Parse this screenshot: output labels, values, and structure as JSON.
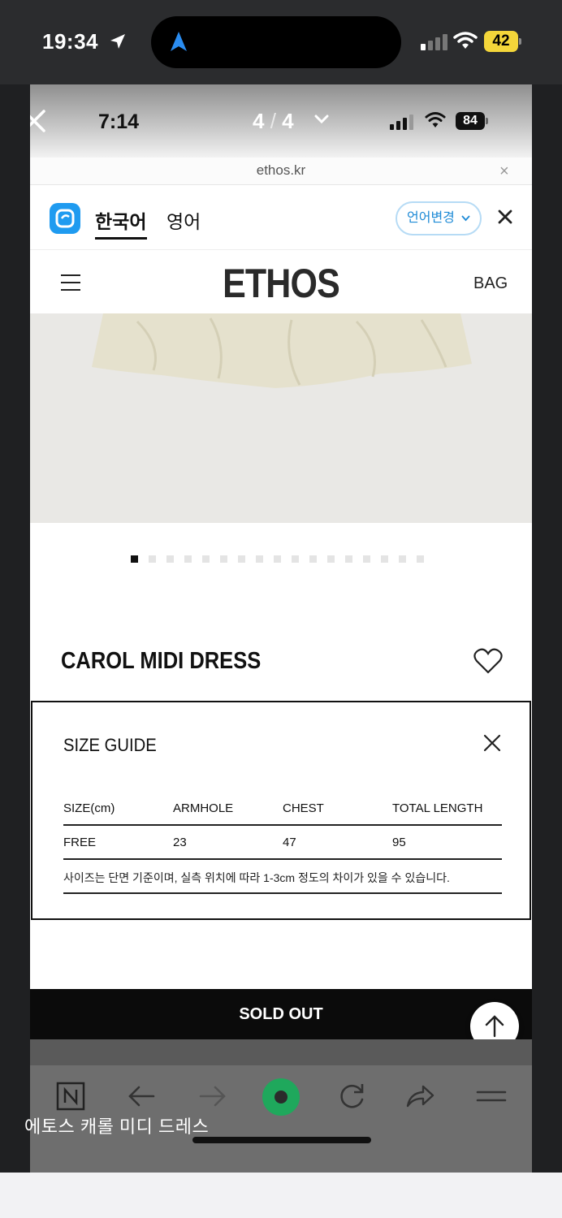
{
  "outer_status": {
    "time": "19:34",
    "battery": "42"
  },
  "viewer": {
    "page_current": "4",
    "page_sep": "/",
    "page_total": "4"
  },
  "inner_status": {
    "time": "7:14",
    "battery": "84"
  },
  "browser": {
    "url": "ethos.kr",
    "url_close": "×"
  },
  "translate_bar": {
    "tab_korean": "한국어",
    "tab_english": "영어",
    "change_language": "언어변경"
  },
  "site": {
    "logo": "ETHOS",
    "bag": "BAG"
  },
  "carousel": {
    "dot_count": 17,
    "active_index": 0
  },
  "product": {
    "name": "CAROL MIDI DRESS"
  },
  "size_guide": {
    "title": "SIZE GUIDE",
    "columns": [
      "SIZE(cm)",
      "ARMHOLE",
      "CHEST",
      "TOTAL LENGTH"
    ],
    "rows": [
      [
        "FREE",
        "23",
        "47",
        "95"
      ]
    ],
    "note": "사이즈는 단면 기준이며, 실측 위치에 따라 1-3cm 정도의 차이가 있을 수 있습니다."
  },
  "sold_out": "SOLD OUT",
  "caption": "에토스 캐롤 미디 드레스",
  "colors": {
    "accent_blue": "#1d8ad6",
    "battery_yellow": "#f4d63a",
    "sold_out_bg": "#0b0b0b",
    "naver_green": "#1fa85c"
  }
}
